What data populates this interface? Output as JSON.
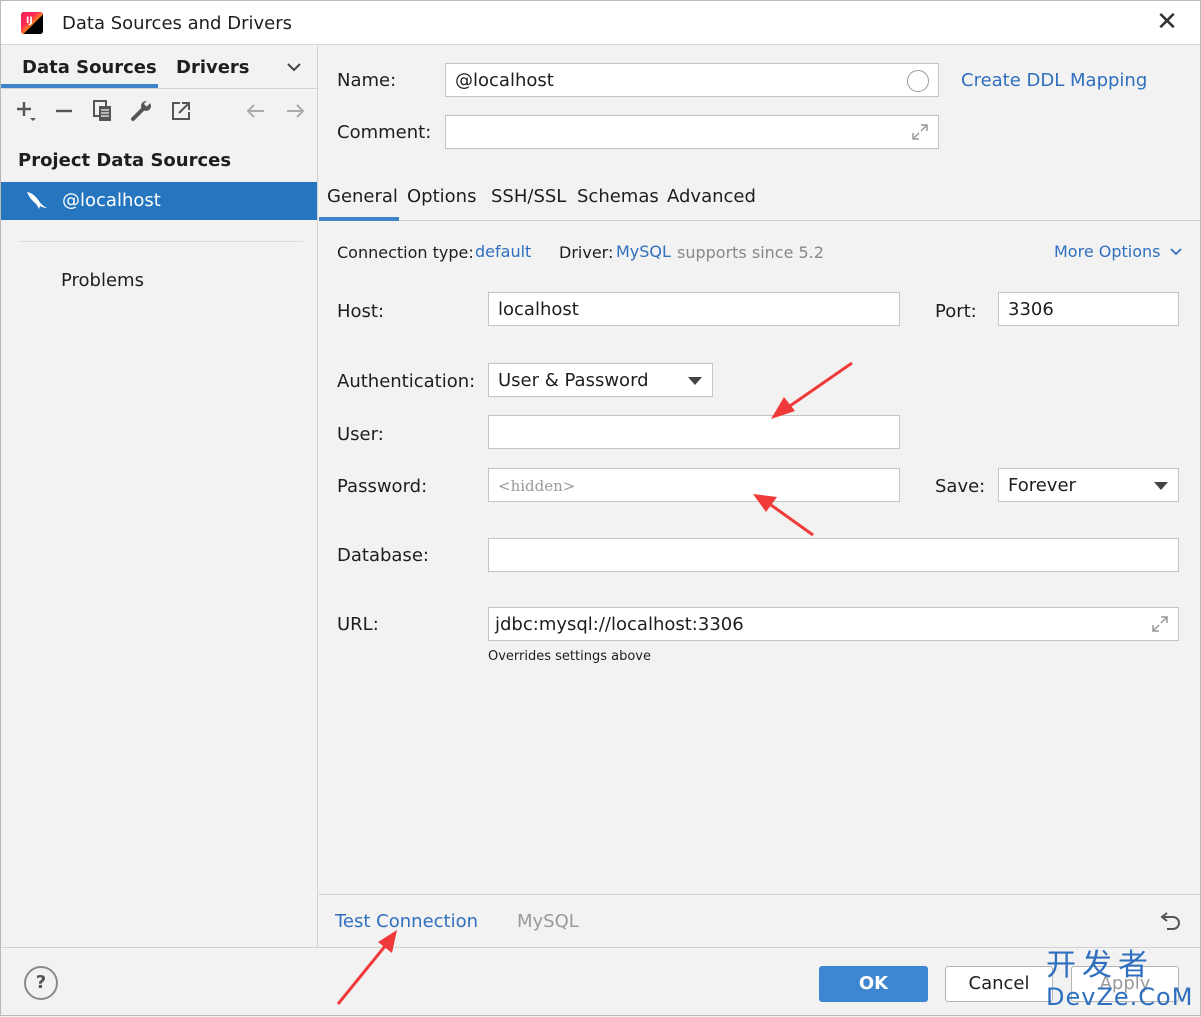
{
  "window": {
    "title": "Data Sources and Drivers",
    "close_glyph": "✕"
  },
  "left": {
    "tabs": [
      "Data Sources",
      "Drivers"
    ],
    "section_title": "Project Data Sources",
    "items": [
      {
        "label": "@localhost"
      }
    ],
    "problems": "Problems"
  },
  "form": {
    "name_label": "Name:",
    "name_value": "@localhost",
    "ddl_link": "Create DDL Mapping",
    "comment_label": "Comment:",
    "comment_value": ""
  },
  "tabs": [
    "General",
    "Options",
    "SSH/SSL",
    "Schemas",
    "Advanced"
  ],
  "general": {
    "conn_type_label": "Connection type:",
    "conn_type_value": "default",
    "driver_label": "Driver:",
    "driver_value": "MySQL",
    "driver_note": "supports since 5.2",
    "more_options": "More Options",
    "host_label": "Host:",
    "host_value": "localhost",
    "port_label": "Port:",
    "port_value": "3306",
    "auth_label": "Authentication:",
    "auth_value": "User & Password",
    "user_label": "User:",
    "user_value": "",
    "password_label": "Password:",
    "password_placeholder": "<hidden>",
    "save_label": "Save:",
    "save_value": "Forever",
    "database_label": "Database:",
    "database_value": "",
    "url_label": "URL:",
    "url_value": "jdbc:mysql://localhost:3306",
    "url_hint": "Overrides settings above"
  },
  "bottom": {
    "test_connection": "Test Connection",
    "driver_name": "MySQL"
  },
  "footer": {
    "help": "?",
    "ok": "OK",
    "cancel": "Cancel",
    "apply": "Apply"
  },
  "watermark": {
    "line1": "开发者",
    "line2": "DevZe.CoM"
  },
  "colors": {
    "accent": "#2675bf",
    "link": "#2f6fbf",
    "annotation": "#f03a3a"
  }
}
